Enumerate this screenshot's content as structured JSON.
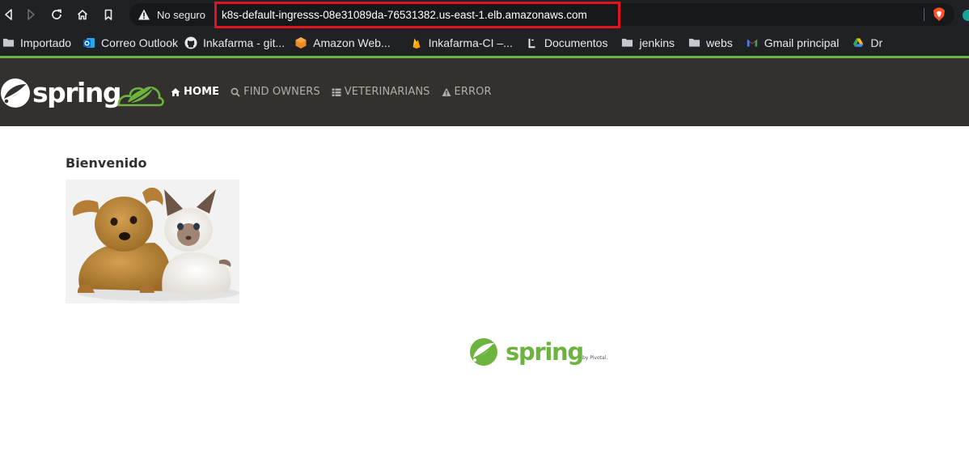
{
  "browser": {
    "security_label": "No seguro",
    "url": "k8s-default-ingresss-08e31089da-76531382.us-east-1.elb.amazonaws.com"
  },
  "bookmarks": [
    {
      "label": "Importado",
      "icon": "folder-icon"
    },
    {
      "label": "Correo Outlook",
      "icon": "outlook-icon"
    },
    {
      "label": "Inkafarma - git...",
      "icon": "github-icon"
    },
    {
      "label": "Amazon Web...",
      "icon": "aws-icon"
    },
    {
      "label": "Inkafarma-CI –...",
      "icon": "firebase-icon"
    },
    {
      "label": "Documentos",
      "icon": "docs-icon"
    },
    {
      "label": "jenkins",
      "icon": "folder-icon"
    },
    {
      "label": "webs",
      "icon": "folder-icon"
    },
    {
      "label": "Gmail principal",
      "icon": "gmail-icon"
    },
    {
      "label": "Dr",
      "icon": "drive-icon"
    }
  ],
  "nav": {
    "home": "HOME",
    "find_owners": "FIND OWNERS",
    "veterinarians": "VETERINARIANS",
    "error": "ERROR"
  },
  "main": {
    "welcome": "Bienvenido"
  },
  "logos": {
    "brand": "spring",
    "footer": "spring",
    "footer_by": "by Pivotal."
  },
  "colors": {
    "spring_green": "#6db33f",
    "navbar_bg": "#34302d",
    "highlight_red": "#e0141c"
  }
}
